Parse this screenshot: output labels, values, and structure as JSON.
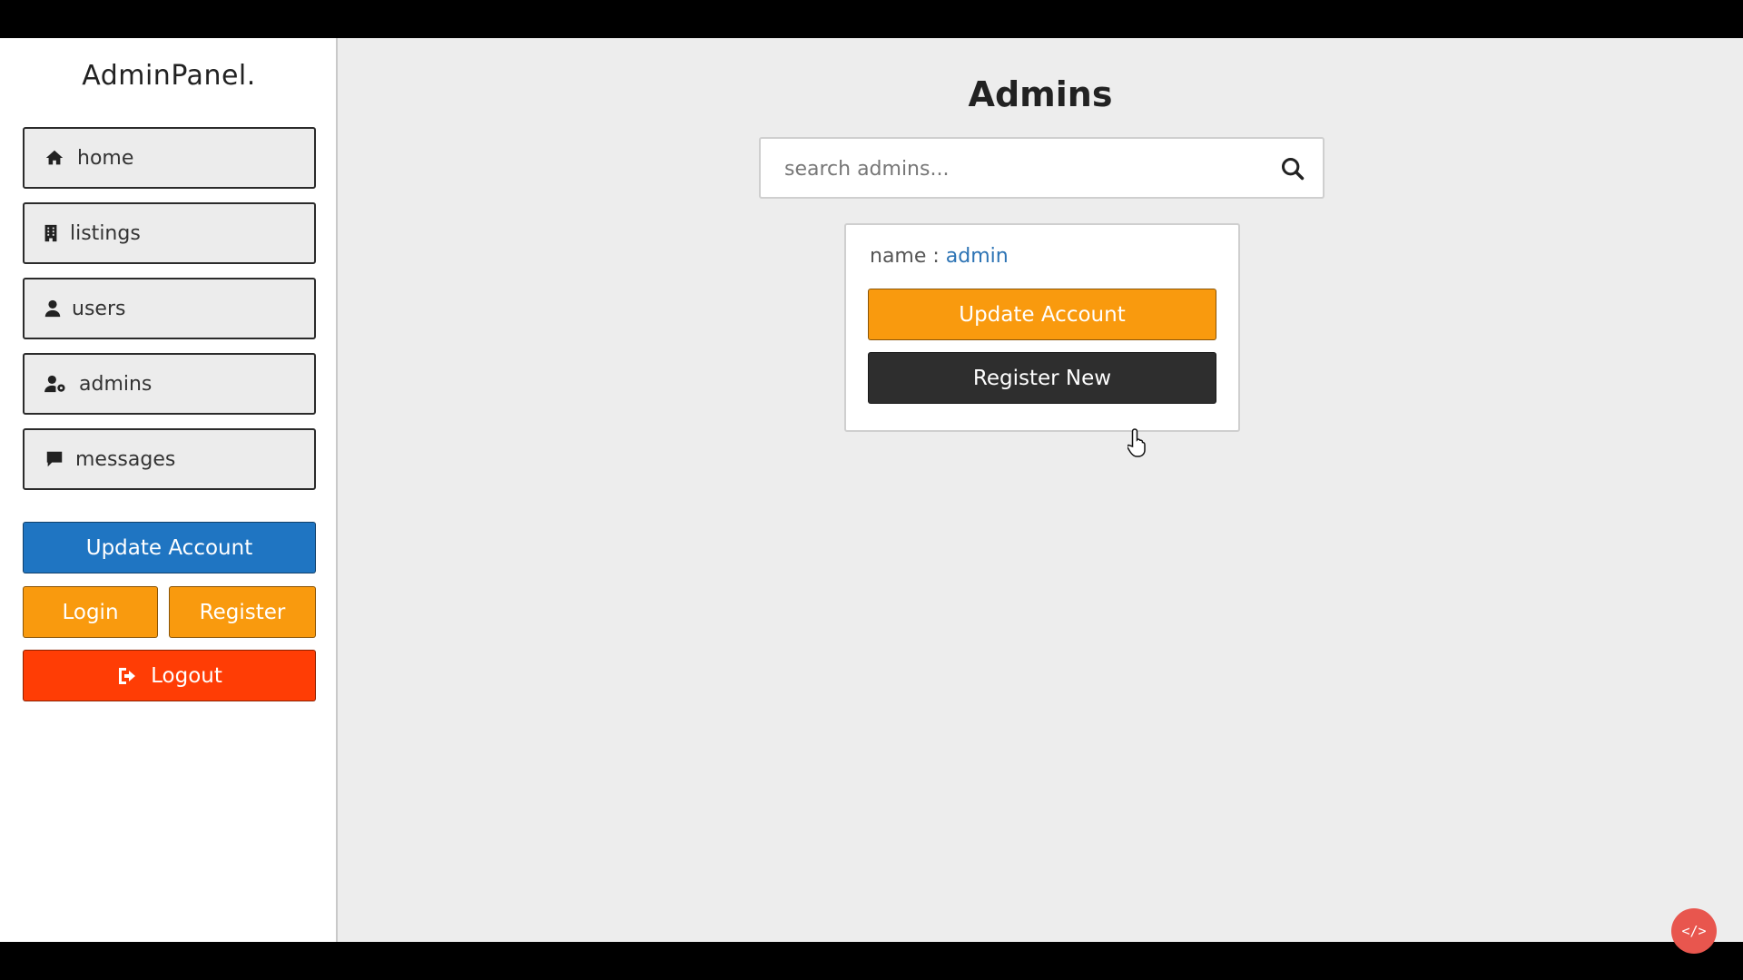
{
  "sidebar": {
    "logo": "AdminPanel.",
    "items": [
      {
        "label": "home",
        "icon": "home-icon"
      },
      {
        "label": "listings",
        "icon": "building-icon"
      },
      {
        "label": "users",
        "icon": "user-icon"
      },
      {
        "label": "admins",
        "icon": "user-gear-icon"
      },
      {
        "label": "messages",
        "icon": "comment-icon"
      }
    ],
    "update_account_label": "Update Account",
    "login_label": "Login",
    "register_label": "Register",
    "logout_label": "Logout"
  },
  "main": {
    "title": "Admins",
    "search": {
      "placeholder": "search admins...",
      "value": ""
    },
    "card": {
      "name_label": "name : ",
      "name_value": "admin",
      "update_label": "Update Account",
      "register_label": "Register New"
    }
  },
  "widget": {
    "label": "</>"
  },
  "colors": {
    "blue": "#1f75c2",
    "orange": "#f99a0e",
    "red": "#ff3d05",
    "dark": "#2e2e2e",
    "link": "#2c73b4"
  }
}
